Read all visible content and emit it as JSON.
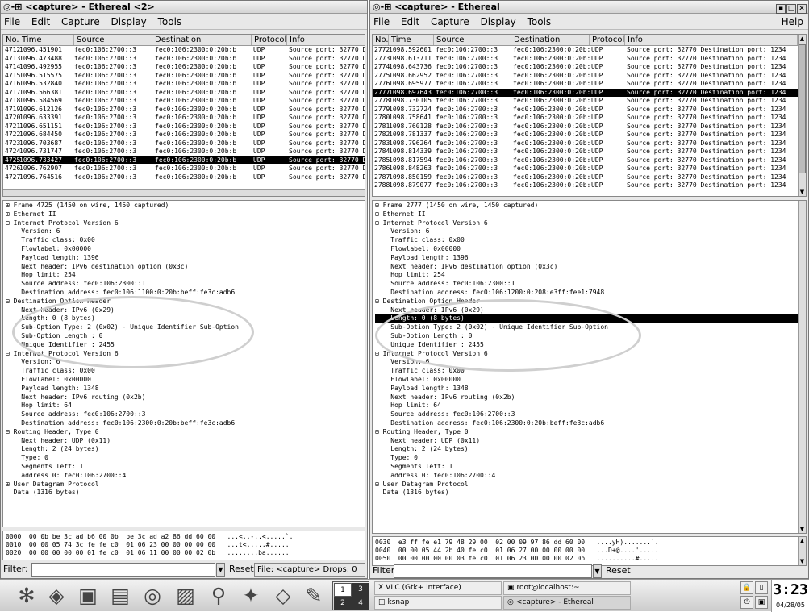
{
  "win1": {
    "title": "<capture> - Ethereal <2>",
    "menu": [
      "File",
      "Edit",
      "Capture",
      "Display",
      "Tools"
    ],
    "headers": [
      "No.",
      "Time",
      "Source",
      "Destination",
      "Protocol",
      "Info"
    ],
    "packets": [
      [
        "4712",
        "1096.451901",
        "fec0:106:2700::3",
        "fec0:106:2300:0:20b:b",
        "UDP",
        "Source port: 32770  Destinatio"
      ],
      [
        "4713",
        "1096.473488",
        "fec0:106:2700::3",
        "fec0:106:2300:0:20b:b",
        "UDP",
        "Source port: 32770  Destinatio"
      ],
      [
        "4714",
        "1096.492955",
        "fec0:106:2700::3",
        "fec0:106:2300:0:20b:b",
        "UDP",
        "Source port: 32770  Destinatio"
      ],
      [
        "4715",
        "1096.515575",
        "fec0:106:2700::3",
        "fec0:106:2300:0:20b:b",
        "UDP",
        "Source port: 32770  Destinatio"
      ],
      [
        "4716",
        "1096.532840",
        "fec0:106:2700::3",
        "fec0:106:2300:0:20b:b",
        "UDP",
        "Source port: 32770  Destinatio"
      ],
      [
        "4717",
        "1096.566381",
        "fec0:106:2700::3",
        "fec0:106:2300:0:20b:b",
        "UDP",
        "Source port: 32770  Destinatio"
      ],
      [
        "4718",
        "1096.584569",
        "fec0:106:2700::3",
        "fec0:106:2300:0:20b:b",
        "UDP",
        "Source port: 32770  Destinatio"
      ],
      [
        "4719",
        "1096.612126",
        "fec0:106:2700::3",
        "fec0:106:2300:0:20b:b",
        "UDP",
        "Source port: 32770  Destinatio"
      ],
      [
        "4720",
        "1096.633391",
        "fec0:106:2700::3",
        "fec0:106:2300:0:20b:b",
        "UDP",
        "Source port: 32770  Destinatio"
      ],
      [
        "4721",
        "1096.651151",
        "fec0:106:2700::3",
        "fec0:106:2300:0:20b:b",
        "UDP",
        "Source port: 32770  Destinatio"
      ],
      [
        "4722",
        "1096.684450",
        "fec0:106:2700::3",
        "fec0:106:2300:0:20b:b",
        "UDP",
        "Source port: 32770  Destinatio"
      ],
      [
        "4723",
        "1096.703687",
        "fec0:106:2700::3",
        "fec0:106:2300:0:20b:b",
        "UDP",
        "Source port: 32770  Destinatio"
      ],
      [
        "4724",
        "1096.731747",
        "fec0:106:2700::3",
        "fec0:106:2300:0:20b:b",
        "UDP",
        "Source port: 32770  Destinatio"
      ],
      [
        "4725",
        "1096.733427",
        "fec0:106:2700::3",
        "fec0:106:2300:0:20b:b",
        "UDP",
        "Source port: 32770  Destinatio"
      ],
      [
        "4726",
        "1096.762907",
        "fec0:106:2700::3",
        "fec0:106:2300:0:20b:b",
        "UDP",
        "Source port: 32770  Destinatio"
      ],
      [
        "4727",
        "1096.764516",
        "fec0:106:2700::3",
        "fec0:106:2300:0:20b:b",
        "UDP",
        "Source port: 32770  Destinatio"
      ]
    ],
    "detail": [
      "⊞ Frame 4725 (1450 on wire, 1450 captured)",
      "⊞ Ethernet II",
      "⊟ Internet Protocol Version 6",
      "    Version: 6",
      "    Traffic class: 0x00",
      "    Flowlabel: 0x00000",
      "    Payload length: 1396",
      "    Next header: IPv6 destination option (0x3c)",
      "    Hop limit: 254",
      "    Source address: fec0:106:2300::1",
      "    Destination address: fec0:106:1100:0:20b:beff:fe3c:adb6",
      "⊟ Destination Option Header",
      "    Next header: IPv6 (0x29)",
      "    Length: 0 (8 bytes)",
      "    Sub-Option Type: 2 (0x02) - Unique Identifier Sub-Option",
      "    Sub-Option Length : 0",
      "    Unique Identifier : 2455",
      "⊟ Internet Protocol Version 6",
      "    Version: 6",
      "    Traffic class: 0x00",
      "    Flowlabel: 0x00000",
      "    Payload length: 1348",
      "    Next header: IPv6 routing (0x2b)",
      "    Hop limit: 64",
      "    Source address: fec0:106:2700::3",
      "    Destination address: fec0:106:2300:0:20b:beff:fe3c:adb6",
      "⊟ Routing Header, Type 0",
      "    Next header: UDP (0x11)",
      "    Length: 2 (24 bytes)",
      "    Type: 0",
      "    Segments left: 1",
      "    address 0: fec0:106:2700::4",
      "⊞ User Datagram Protocol",
      "  Data (1316 bytes)"
    ],
    "hex": [
      "0000  00 0b be 3c ad b6 00 0b  be 3c ad a2 86 dd 60 00   ...<..-..<.....`.",
      "0010  00 00 05 74 3c fe fe c0  01 06 23 00 00 00 00 00   ...t<.....#.....",
      "0020  00 00 00 00 00 01 fe c0  01 06 11 00 00 00 02 0b   ........ba......"
    ],
    "filter_label": "Filter:",
    "filter_value": "",
    "reset_label": "Reset",
    "status": "File: <capture>  Drops: 0"
  },
  "win2": {
    "title": "<capture> - Ethereal",
    "menu": [
      "File",
      "Edit",
      "Capture",
      "Display",
      "Tools"
    ],
    "help": "Help",
    "headers": [
      "No.",
      "Time",
      "Source",
      "Destination",
      "Protocol",
      "Info"
    ],
    "packets": [
      [
        "2772",
        "1098.592601",
        "fec0:106:2700::3",
        "fec0:106:2300:0:20b:b",
        "UDP",
        "Source port: 32770  Destination port: 1234"
      ],
      [
        "2773",
        "1098.613711",
        "fec0:106:2700::3",
        "fec0:106:2300:0:20b:b",
        "UDP",
        "Source port: 32770  Destination port: 1234"
      ],
      [
        "2774",
        "1098.643736",
        "fec0:106:2700::3",
        "fec0:106:2300:0:20b:b",
        "UDP",
        "Source port: 32770  Destination port: 1234"
      ],
      [
        "2775",
        "1098.662952",
        "fec0:106:2700::3",
        "fec0:106:2300:0:20b:b",
        "UDP",
        "Source port: 32770  Destination port: 1234"
      ],
      [
        "2776",
        "1098.695977",
        "fec0:106:2700::3",
        "fec0:106:2300:0:20b:b",
        "UDP",
        "Source port: 32770  Destination port: 1234"
      ],
      [
        "2777",
        "1098.697643",
        "fec0:106:2700::3",
        "fec0:106:2300:0:20b:b",
        "UDP",
        "Source port: 32770  Destination port: 1234"
      ],
      [
        "2778",
        "1098.730105",
        "fec0:106:2700::3",
        "fec0:106:2300:0:20b:b",
        "UDP",
        "Source port: 32770  Destination port: 1234"
      ],
      [
        "2779",
        "1098.732724",
        "fec0:106:2700::3",
        "fec0:106:2300:0:20b:b",
        "UDP",
        "Source port: 32770  Destination port: 1234"
      ],
      [
        "2780",
        "1098.758641",
        "fec0:106:2700::3",
        "fec0:106:2300:0:20b:b",
        "UDP",
        "Source port: 32770  Destination port: 1234"
      ],
      [
        "2781",
        "1098.760128",
        "fec0:106:2700::3",
        "fec0:106:2300:0:20b:b",
        "UDP",
        "Source port: 32770  Destination port: 1234"
      ],
      [
        "2782",
        "1098.781337",
        "fec0:106:2700::3",
        "fec0:106:2300:0:20b:b",
        "UDP",
        "Source port: 32770  Destination port: 1234"
      ],
      [
        "2783",
        "1098.796264",
        "fec0:106:2700::3",
        "fec0:106:2300:0:20b:b",
        "UDP",
        "Source port: 32770  Destination port: 1234"
      ],
      [
        "2784",
        "1098.814339",
        "fec0:106:2700::3",
        "fec0:106:2300:0:20b:b",
        "UDP",
        "Source port: 32770  Destination port: 1234"
      ],
      [
        "2785",
        "1098.817594",
        "fec0:106:2700::3",
        "fec0:106:2300:0:20b:b",
        "UDP",
        "Source port: 32770  Destination port: 1234"
      ],
      [
        "2786",
        "1098.848263",
        "fec0:106:2700::3",
        "fec0:106:2300:0:20b:b",
        "UDP",
        "Source port: 32770  Destination port: 1234"
      ],
      [
        "2787",
        "1098.850159",
        "fec0:106:2700::3",
        "fec0:106:2300:0:20b:b",
        "UDP",
        "Source port: 32770  Destination port: 1234"
      ],
      [
        "2788",
        "1098.879077",
        "fec0:106:2700::3",
        "fec0:106:2300:0:20b:b",
        "UDP",
        "Source port: 32770  Destination port: 1234"
      ]
    ],
    "detail": [
      "⊞ Frame 2777 (1450 on wire, 1450 captured)",
      "⊞ Ethernet II",
      "⊟ Internet Protocol Version 6",
      "    Version: 6",
      "    Traffic class: 0x00",
      "    Flowlabel: 0x00000",
      "    Payload length: 1396",
      "    Next header: IPv6 destination option (0x3c)",
      "    Hop limit: 254",
      "    Source address: fec0:106:2300::1",
      "    Destination address: fec0:106:1200:0:208:e3ff:fee1:7948",
      "⊟ Destination Option Header",
      "    Next header: IPv6 (0x29)",
      "    Length: 0 (8 bytes)",
      "    Sub-Option Type: 2 (0x02) - Unique Identifier Sub-Option",
      "    Sub-Option Length : 0",
      "    Unique Identifier : 2455",
      "⊟ Internet Protocol Version 6",
      "    Version: 6",
      "    Traffic class: 0x00",
      "    Flowlabel: 0x00000",
      "    Payload length: 1348",
      "    Next header: IPv6 routing (0x2b)",
      "    Hop limit: 64",
      "    Source address: fec0:106:2700::3",
      "    Destination address: fec0:106:2300:0:20b:beff:fe3c:adb6",
      "⊟ Routing Header, Type 0",
      "    Next header: UDP (0x11)",
      "    Length: 2 (24 bytes)",
      "    Type: 0",
      "    Segments left: 1",
      "    address 0: fec0:106:2700::4",
      "⊞ User Datagram Protocol",
      "  Data (1316 bytes)"
    ],
    "hex": [
      "0030  e3 ff fe e1 79 48 29 00  02 00 09 97 86 dd 60 00   ....yH).......`.",
      "0040  00 00 05 44 2b 40 fe c0  01 06 27 00 00 00 00 00   ...D+@....'.....",
      "0050  00 00 00 00 00 03 fe c0  01 06 23 00 00 00 02 0b   ..........#....."
    ],
    "filter_label": "Filter:",
    "filter_value": "",
    "reset_label": "Reset"
  },
  "taskbar": {
    "launchers": [
      "kde",
      "app",
      "window",
      "monitor",
      "lifebuoy",
      "landscape",
      "search",
      "network",
      "cube",
      "pencil"
    ],
    "pager": [
      "1",
      "2",
      "3",
      "4"
    ],
    "tasks": [
      {
        "icon": "X",
        "label": "VLC (Gtk+ interface)"
      },
      {
        "icon": "▣",
        "label": "root@localhost:~"
      },
      {
        "icon": "◫",
        "label": "ksnap"
      },
      {
        "icon": "◎",
        "label": "<capture> - Ethereal"
      }
    ],
    "clock": "3:23",
    "date": "04/28/05"
  },
  "colors": {
    "selection": "#000000",
    "window_bg": "#e8e8e8",
    "pane_bg": "#ffffff"
  }
}
